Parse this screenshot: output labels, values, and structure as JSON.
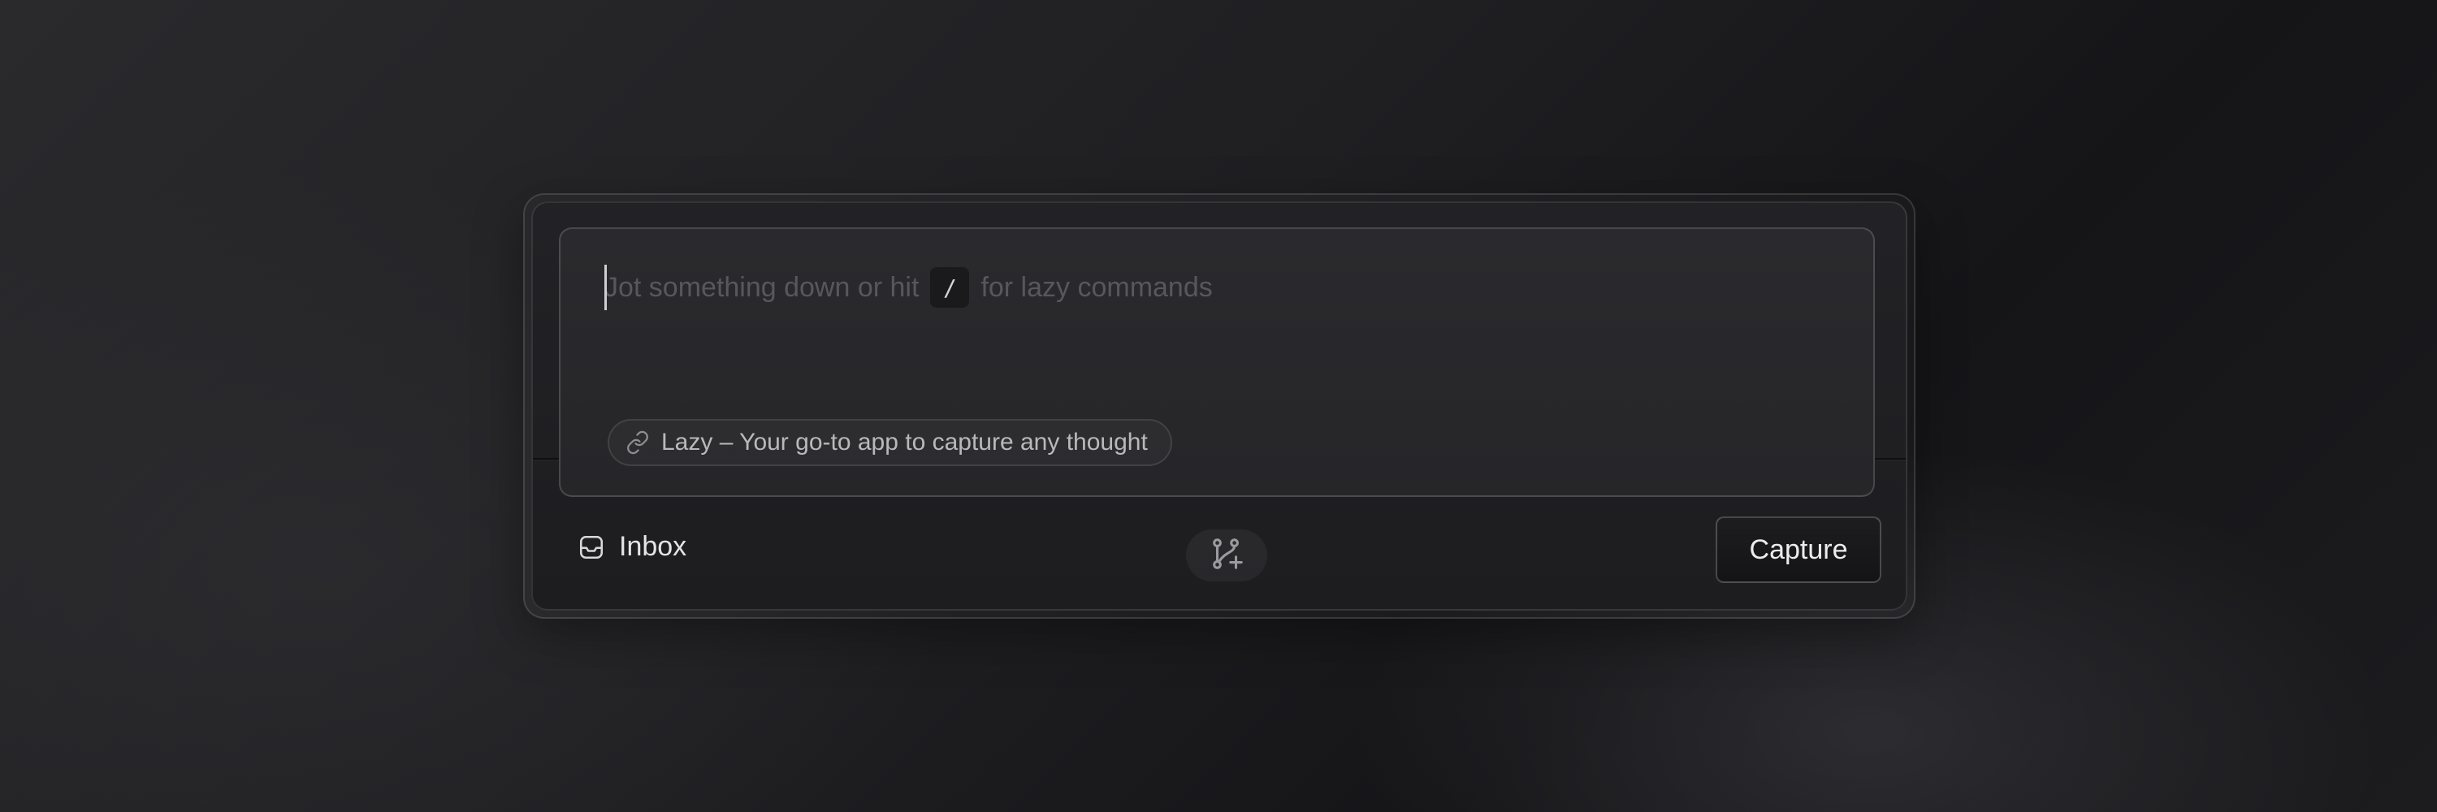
{
  "editor": {
    "placeholder_before": "Jot something down or hit",
    "shortcut_key": "/",
    "placeholder_after": "for lazy commands"
  },
  "link_chip": {
    "icon": "link-icon",
    "label": "Lazy – Your go-to app to capture any thought"
  },
  "footer": {
    "inbox": {
      "icon": "inbox-icon",
      "label": "Inbox"
    },
    "branch_icon": "git-branch-plus-icon",
    "capture_label": "Capture"
  }
}
